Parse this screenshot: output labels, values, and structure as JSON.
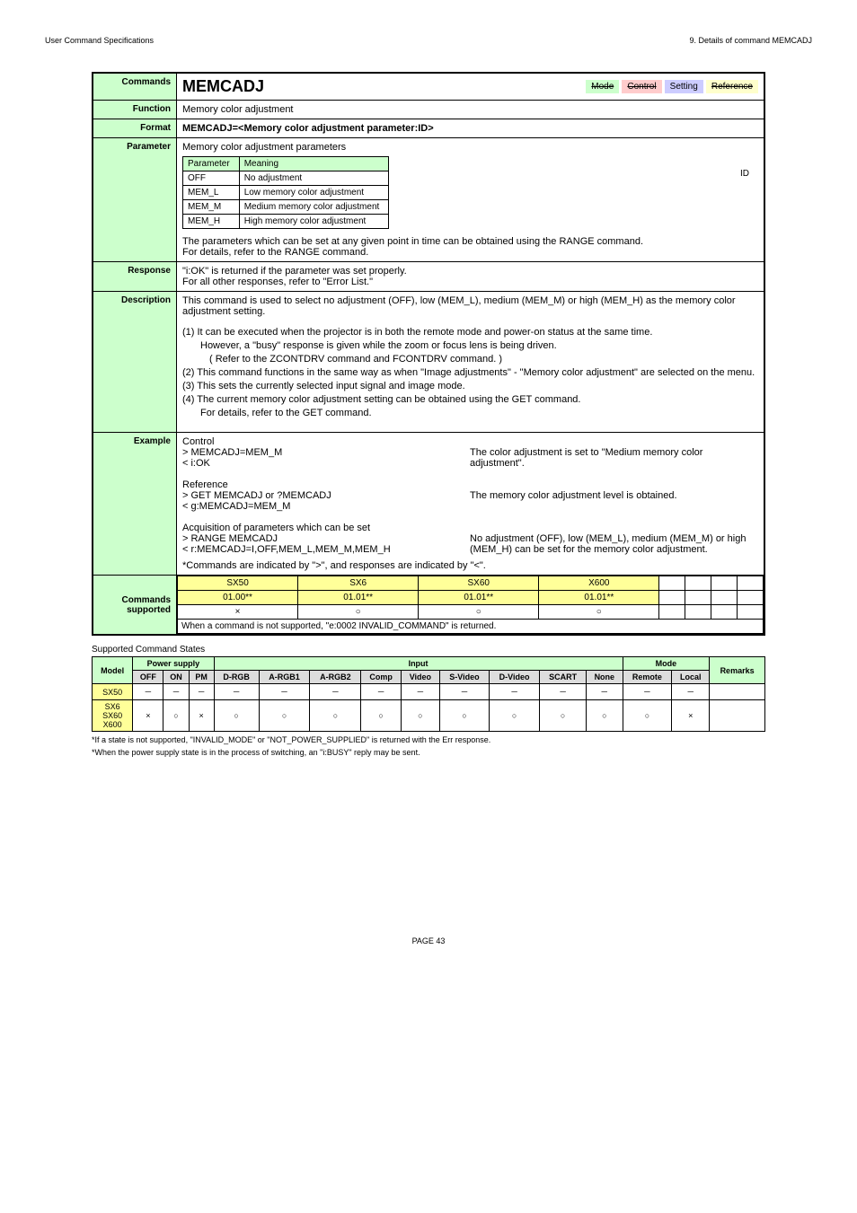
{
  "header": {
    "left": "User Command Specifications",
    "right": "9. Details of command MEMCADJ"
  },
  "labels": {
    "commands": "Commands",
    "function": "Function",
    "format": "Format",
    "parameter": "Parameter",
    "response": "Response",
    "description": "Description",
    "example": "Example",
    "commands_supported": "Commands supported"
  },
  "command": {
    "name": "MEMCADJ",
    "tags": {
      "mode": "Mode",
      "control": "Control",
      "setting": "Setting",
      "reference": "Reference"
    },
    "function": "Memory color adjustment",
    "format": "MEMCADJ=<Memory color adjustment parameter:ID>"
  },
  "parameter": {
    "intro": "Memory color adjustment parameters",
    "th1": "Parameter",
    "th2": "Meaning",
    "rows": [
      {
        "p": "OFF",
        "m": "No adjustment"
      },
      {
        "p": "MEM_L",
        "m": "Low memory color adjustment"
      },
      {
        "p": "MEM_M",
        "m": "Medium memory color adjustment"
      },
      {
        "p": "MEM_H",
        "m": "High memory color adjustment"
      }
    ],
    "id_label": "ID",
    "note1": "The parameters which can be set at any given point in time can be obtained using the RANGE command.",
    "note2": "For details, refer to the RANGE command."
  },
  "response": {
    "line1": "\"i:OK\" is returned if the parameter was set properly.",
    "line2": "For all other responses, refer to \"Error List.\""
  },
  "description": {
    "intro": "This command is used to select no adjustment (OFF), low (MEM_L), medium (MEM_M) or high (MEM_H) as the memory color adjustment setting.",
    "items": [
      "(1) It can be executed when the projector is in both the remote mode and power-on status at the same time.",
      "However, a \"busy\" response is given while the zoom or focus lens is being driven.",
      "( Refer to the ZCONTDRV command and FCONTDRV command. )",
      "(2) This command functions in the same way as when \"Image adjustments\" - \"Memory color adjustment\" are selected on the menu.",
      "(3) This sets the currently selected input signal and image mode.",
      "(4) The current memory color adjustment setting can be obtained using the GET command.",
      "For details, refer to the GET command."
    ]
  },
  "example": {
    "control_label": "Control",
    "ctrl_cmd1": "> MEMCADJ=MEM_M",
    "ctrl_cmd2": "< i:OK",
    "ctrl_desc": "The color adjustment is set to \"Medium memory color adjustment\".",
    "ref_label": "Reference",
    "ref_cmd1": "> GET MEMCADJ or ?MEMCADJ",
    "ref_cmd2": "< g:MEMCADJ=MEM_M",
    "ref_desc": "The memory color adjustment level is obtained.",
    "acq_label": "Acquisition of parameters which can be set",
    "acq_cmd1": "> RANGE MEMCADJ",
    "acq_cmd2": "< r:MEMCADJ=I,OFF,MEM_L,MEM_M,MEM_H",
    "acq_desc": "No adjustment (OFF), low (MEM_L), medium (MEM_M) or high (MEM_H) can be set for the memory color adjustment.",
    "footnote": "*Commands are indicated by \">\", and responses are indicated by \"<\"."
  },
  "sub": {
    "models": [
      "SX50",
      "SX6",
      "SX60",
      "X600"
    ],
    "vers": [
      "01.00**",
      "01.01**",
      "01.01**",
      "01.01**"
    ],
    "marks": [
      "×",
      "○",
      "○",
      "○"
    ],
    "note": "When a command is not supported, \"e:0002 INVALID_COMMAND\" is returned."
  },
  "states": {
    "title": "Supported Command States",
    "group_headers": {
      "model": "Model",
      "power": "Power supply",
      "input": "Input",
      "mode": "Mode",
      "remarks": "Remarks"
    },
    "cols": [
      "OFF",
      "ON",
      "PM",
      "D-RGB",
      "A-RGB1",
      "A-RGB2",
      "Comp",
      "Video",
      "S-Video",
      "D-Video",
      "SCART",
      "None",
      "Remote",
      "Local"
    ],
    "rows": [
      {
        "model": "SX50",
        "vals": [
          "－",
          "－",
          "－",
          "－",
          "－",
          "－",
          "－",
          "－",
          "－",
          "－",
          "－",
          "－",
          "－",
          "－"
        ],
        "cls": "state-model-yellow"
      },
      {
        "model": "SX6",
        "vals": [
          "×",
          "○",
          "×",
          "○",
          "○",
          "○",
          "○",
          "○",
          "○",
          "○",
          "○",
          "○",
          "○",
          "×"
        ],
        "cls": "state-model-yellow"
      },
      {
        "model": "SX60",
        "vals": [
          "",
          "",
          "",
          "",
          "",
          "",
          "",
          "",
          "",
          "",
          "",
          "",
          "",
          ""
        ],
        "cls": "state-model-yellow"
      },
      {
        "model": "X600",
        "vals": [
          "",
          "",
          "",
          "",
          "",
          "",
          "",
          "",
          "",
          "",
          "",
          "",
          "",
          ""
        ],
        "cls": "state-model-yellow"
      }
    ],
    "foot1": "*If a state is not supported, \"INVALID_MODE\" or \"NOT_POWER_SUPPLIED\" is returned with the Err response.",
    "foot2": "*When the power supply state is in the process of switching, an \"i:BUSY\" reply may be sent."
  },
  "page": "PAGE 43"
}
